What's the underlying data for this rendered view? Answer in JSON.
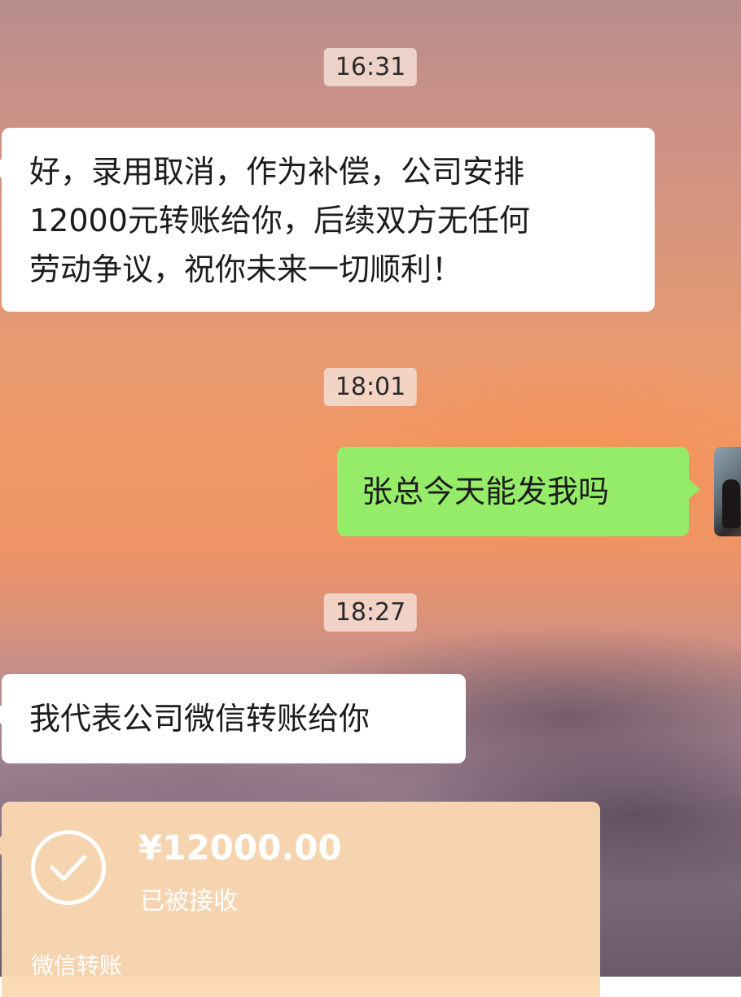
{
  "chat": {
    "timestamps": [
      "16:31",
      "18:01",
      "18:27"
    ],
    "messages": [
      {
        "direction": "incoming",
        "lines": [
          "好，录用取消，作为补偿，公司安排",
          "12000元转账给你，后续双方无任何",
          "劳动争议，祝你未来一切顺利！"
        ]
      },
      {
        "direction": "outgoing",
        "text": "张总今天能发我吗"
      },
      {
        "direction": "incoming",
        "text": "我代表公司微信转账给你"
      }
    ],
    "transfer": {
      "amount": "¥12000.00",
      "status": "已被接收",
      "label": "微信转账",
      "icon": "check-circle-icon",
      "color": "#fbd8b2"
    }
  },
  "colors": {
    "incoming_bubble": "#ffffff",
    "outgoing_bubble": "#95ec69"
  }
}
